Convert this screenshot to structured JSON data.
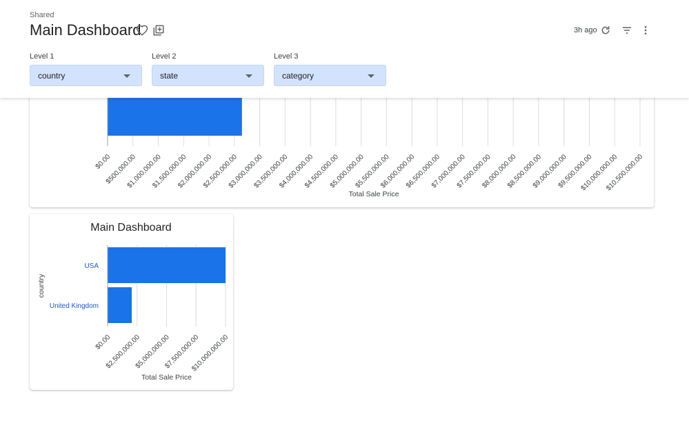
{
  "breadcrumb": "Shared",
  "page_title": "Main Dashboard",
  "toolbar": {
    "updated": "3h ago"
  },
  "filters": [
    {
      "label": "Level 1",
      "value": "country"
    },
    {
      "label": "Level 2",
      "value": "state"
    },
    {
      "label": "Level 3",
      "value": "category"
    }
  ],
  "colors": {
    "bar": "#1a73e8",
    "filter_bg": "#d3e3fd",
    "category_label": "#1a57c2"
  },
  "icons": [
    "heart-icon",
    "add-to-board-icon",
    "refresh-icon",
    "filter-icon",
    "more-vert-icon"
  ],
  "chart_data": [
    {
      "type": "bar",
      "orientation": "horizontal",
      "categories": [
        ""
      ],
      "values": [
        2650000
      ],
      "xlabel": "Total Sale Price",
      "ylabel": "",
      "xlim": [
        0,
        10500000
      ],
      "ticks": [
        "$0.00",
        "$500,000.00",
        "$1,000,000.00",
        "$1,500,000.00",
        "$2,000,000.00",
        "$2,500,000.00",
        "$3,000,000.00",
        "$3,500,000.00",
        "$4,000,000.00",
        "$4,500,000.00",
        "$5,000,000.00",
        "$5,500,000.00",
        "$6,000,000.00",
        "$6,500,000.00",
        "$7,000,000.00",
        "$7,500,000.00",
        "$8,000,000.00",
        "$8,500,000.00",
        "$9,000,000.00",
        "$9,500,000.00",
        "$10,000,000.00",
        "$10,500,000.00"
      ],
      "grid": true
    },
    {
      "type": "bar",
      "orientation": "horizontal",
      "title": "Main Dashboard",
      "categories": [
        "USA",
        "United Kingdom"
      ],
      "values": [
        10500000,
        2150000
      ],
      "xlabel": "Total Sale Price",
      "ylabel": "country",
      "xlim": [
        0,
        10500000
      ],
      "ticks": [
        "$0.00",
        "$2,500,000.00",
        "$5,000,000.00",
        "$7,500,000.00",
        "$10,000,000.00"
      ],
      "grid": true
    }
  ]
}
